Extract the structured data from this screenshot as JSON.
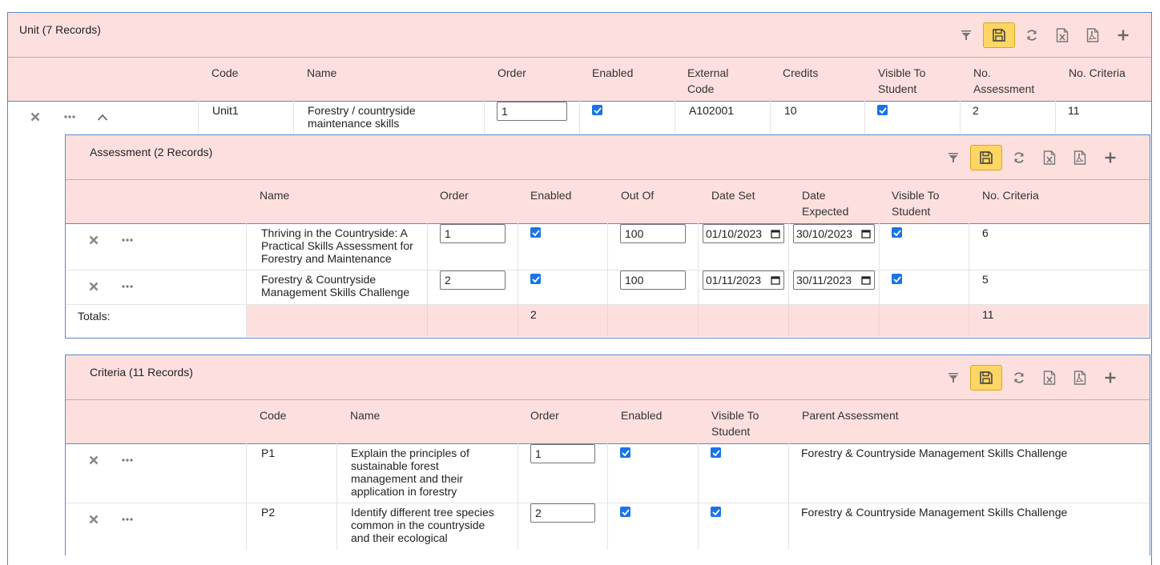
{
  "unit": {
    "title": "Unit (7 Records)",
    "headers": [
      "Code",
      "Name",
      "Order",
      "Enabled",
      "External Code",
      "Credits",
      "Visible To Student",
      "No. Assessment",
      "No. Criteria"
    ],
    "row": {
      "code": "Unit1",
      "name": "Forestry / countryside maintenance skills",
      "order": "1",
      "enabled": true,
      "external_code": "A102001",
      "credits": "10",
      "visible_to_student": true,
      "no_assessment": "2",
      "no_criteria": "11"
    }
  },
  "assessment": {
    "title": "Assessment (2 Records)",
    "headers": [
      "Name",
      "Order",
      "Enabled",
      "Out Of",
      "Date Set",
      "Date Expected",
      "Visible To Student",
      "No. Criteria"
    ],
    "rows": [
      {
        "name": "Thriving in the Countryside: A Practical Skills Assessment for Forestry and Maintenance",
        "order": "1",
        "enabled": true,
        "out_of": "100",
        "date_set": "01/10/2023",
        "date_expected": "30/10/2023",
        "visible": true,
        "no_criteria": "6"
      },
      {
        "name": "Forestry & Countryside Management Skills Challenge",
        "order": "2",
        "enabled": true,
        "out_of": "100",
        "date_set": "01/11/2023",
        "date_expected": "30/11/2023",
        "visible": true,
        "no_criteria": "5"
      }
    ],
    "totals": {
      "label": "Totals:",
      "enabled": "2",
      "no_criteria": "11"
    }
  },
  "criteria": {
    "title": "Criteria (11 Records)",
    "headers": [
      "Code",
      "Name",
      "Order",
      "Enabled",
      "Visible To Student",
      "Parent Assessment"
    ],
    "rows": [
      {
        "code": "P1",
        "name": "Explain the principles of sustainable forest management and their application in forestry",
        "order": "1",
        "enabled": true,
        "visible": true,
        "parent": "Forestry & Countryside Management Skills Challenge"
      },
      {
        "code": "P2",
        "name": "Identify different tree species common in the countryside and their ecological",
        "order": "2",
        "enabled": true,
        "visible": true,
        "parent": "Forestry & Countryside Management Skills Challenge"
      }
    ]
  },
  "toolbar_icons": [
    "filter-icon",
    "save-icon",
    "refresh-icon",
    "excel-export-icon",
    "pdf-export-icon",
    "add-icon"
  ],
  "colors": {
    "header_bg": "#fde0de",
    "save_button": "#fdd663",
    "panel_border": "#5b88c9",
    "checkbox": "#1a73e8"
  }
}
